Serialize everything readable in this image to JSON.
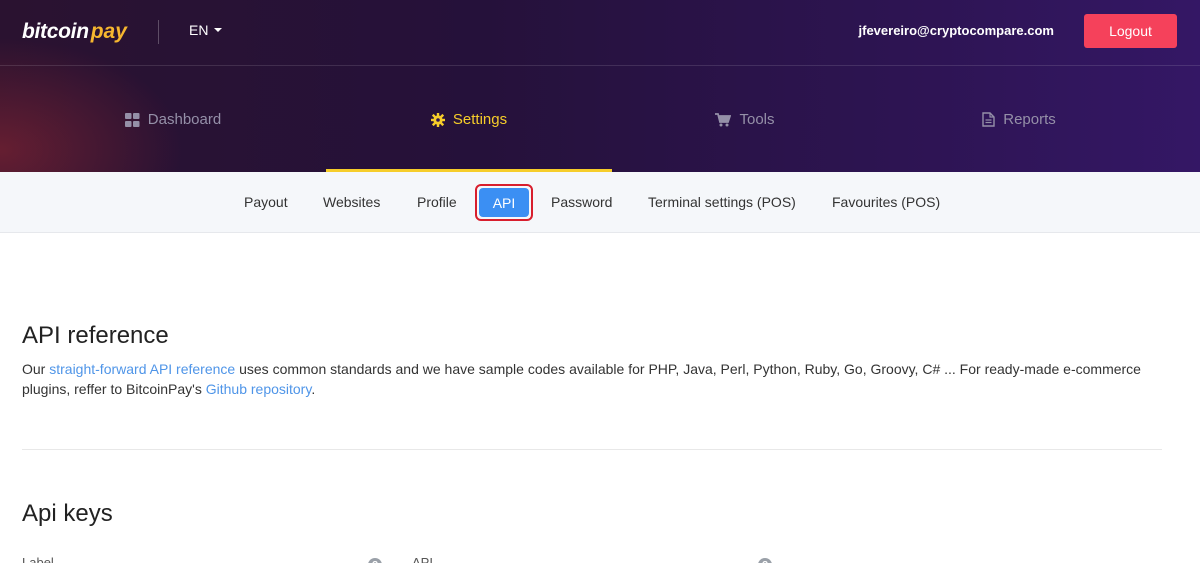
{
  "header": {
    "logo": {
      "part1": "bitcoin",
      "part2": "pay"
    },
    "language": "EN",
    "user_email": "jfevereiro@cryptocompare.com",
    "logout_label": "Logout"
  },
  "main_nav": [
    {
      "label": "Dashboard",
      "icon": "dashboard-icon",
      "active": false
    },
    {
      "label": "Settings",
      "icon": "gear-icon",
      "active": true
    },
    {
      "label": "Tools",
      "icon": "cart-icon",
      "active": false
    },
    {
      "label": "Reports",
      "icon": "document-icon",
      "active": false
    }
  ],
  "sub_nav": [
    {
      "label": "Payout",
      "active": false
    },
    {
      "label": "Websites",
      "active": false
    },
    {
      "label": "Profile",
      "active": false
    },
    {
      "label": "API",
      "active": true
    },
    {
      "label": "Password",
      "active": false
    },
    {
      "label": "Terminal settings (POS)",
      "active": false
    },
    {
      "label": "Favourites (POS)",
      "active": false
    }
  ],
  "api_reference": {
    "title": "API reference",
    "text_before_link1": "Our ",
    "link1": "straight-forward API reference",
    "text_middle": " uses common standards and we have sample codes available for PHP, Java, Perl, Python, Ruby, Go, Groovy, C# ... For ready-made e-commerce plugins, reffer to BitcoinPay's ",
    "link2": "Github repository",
    "text_after": "."
  },
  "api_keys": {
    "title": "Api keys",
    "columns": [
      {
        "label": "Label"
      },
      {
        "label": "API"
      },
      {
        "label": ""
      }
    ]
  },
  "colors": {
    "accent_yellow": "#f6cd2a",
    "logout_red": "#f5415b",
    "api_blue": "#3b8ff3",
    "highlight_red": "#d81e2d",
    "link_blue": "#4f95e8"
  }
}
